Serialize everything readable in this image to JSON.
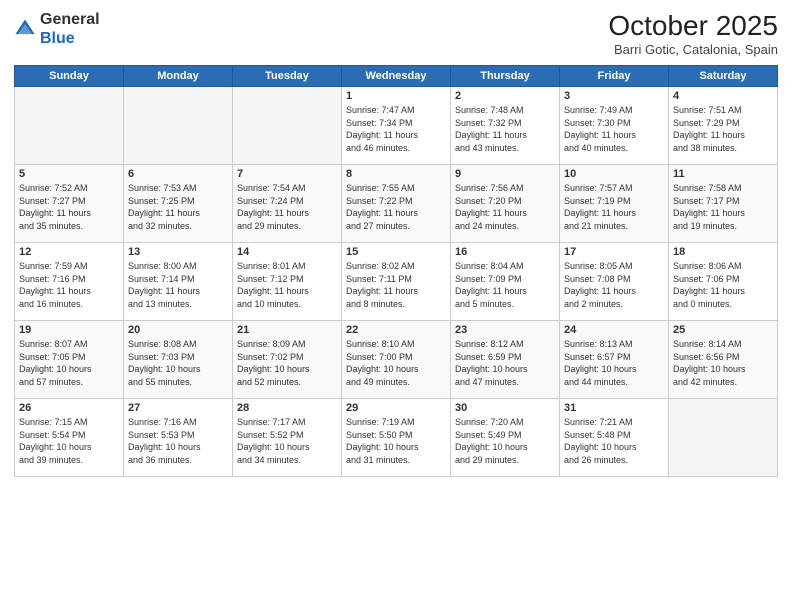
{
  "header": {
    "logo_line1": "General",
    "logo_line2": "Blue",
    "month_title": "October 2025",
    "location": "Barri Gotic, Catalonia, Spain"
  },
  "weekdays": [
    "Sunday",
    "Monday",
    "Tuesday",
    "Wednesday",
    "Thursday",
    "Friday",
    "Saturday"
  ],
  "weeks": [
    [
      {
        "day": "",
        "info": ""
      },
      {
        "day": "",
        "info": ""
      },
      {
        "day": "",
        "info": ""
      },
      {
        "day": "1",
        "info": "Sunrise: 7:47 AM\nSunset: 7:34 PM\nDaylight: 11 hours\nand 46 minutes."
      },
      {
        "day": "2",
        "info": "Sunrise: 7:48 AM\nSunset: 7:32 PM\nDaylight: 11 hours\nand 43 minutes."
      },
      {
        "day": "3",
        "info": "Sunrise: 7:49 AM\nSunset: 7:30 PM\nDaylight: 11 hours\nand 40 minutes."
      },
      {
        "day": "4",
        "info": "Sunrise: 7:51 AM\nSunset: 7:29 PM\nDaylight: 11 hours\nand 38 minutes."
      }
    ],
    [
      {
        "day": "5",
        "info": "Sunrise: 7:52 AM\nSunset: 7:27 PM\nDaylight: 11 hours\nand 35 minutes."
      },
      {
        "day": "6",
        "info": "Sunrise: 7:53 AM\nSunset: 7:25 PM\nDaylight: 11 hours\nand 32 minutes."
      },
      {
        "day": "7",
        "info": "Sunrise: 7:54 AM\nSunset: 7:24 PM\nDaylight: 11 hours\nand 29 minutes."
      },
      {
        "day": "8",
        "info": "Sunrise: 7:55 AM\nSunset: 7:22 PM\nDaylight: 11 hours\nand 27 minutes."
      },
      {
        "day": "9",
        "info": "Sunrise: 7:56 AM\nSunset: 7:20 PM\nDaylight: 11 hours\nand 24 minutes."
      },
      {
        "day": "10",
        "info": "Sunrise: 7:57 AM\nSunset: 7:19 PM\nDaylight: 11 hours\nand 21 minutes."
      },
      {
        "day": "11",
        "info": "Sunrise: 7:58 AM\nSunset: 7:17 PM\nDaylight: 11 hours\nand 19 minutes."
      }
    ],
    [
      {
        "day": "12",
        "info": "Sunrise: 7:59 AM\nSunset: 7:16 PM\nDaylight: 11 hours\nand 16 minutes."
      },
      {
        "day": "13",
        "info": "Sunrise: 8:00 AM\nSunset: 7:14 PM\nDaylight: 11 hours\nand 13 minutes."
      },
      {
        "day": "14",
        "info": "Sunrise: 8:01 AM\nSunset: 7:12 PM\nDaylight: 11 hours\nand 10 minutes."
      },
      {
        "day": "15",
        "info": "Sunrise: 8:02 AM\nSunset: 7:11 PM\nDaylight: 11 hours\nand 8 minutes."
      },
      {
        "day": "16",
        "info": "Sunrise: 8:04 AM\nSunset: 7:09 PM\nDaylight: 11 hours\nand 5 minutes."
      },
      {
        "day": "17",
        "info": "Sunrise: 8:05 AM\nSunset: 7:08 PM\nDaylight: 11 hours\nand 2 minutes."
      },
      {
        "day": "18",
        "info": "Sunrise: 8:06 AM\nSunset: 7:06 PM\nDaylight: 11 hours\nand 0 minutes."
      }
    ],
    [
      {
        "day": "19",
        "info": "Sunrise: 8:07 AM\nSunset: 7:05 PM\nDaylight: 10 hours\nand 57 minutes."
      },
      {
        "day": "20",
        "info": "Sunrise: 8:08 AM\nSunset: 7:03 PM\nDaylight: 10 hours\nand 55 minutes."
      },
      {
        "day": "21",
        "info": "Sunrise: 8:09 AM\nSunset: 7:02 PM\nDaylight: 10 hours\nand 52 minutes."
      },
      {
        "day": "22",
        "info": "Sunrise: 8:10 AM\nSunset: 7:00 PM\nDaylight: 10 hours\nand 49 minutes."
      },
      {
        "day": "23",
        "info": "Sunrise: 8:12 AM\nSunset: 6:59 PM\nDaylight: 10 hours\nand 47 minutes."
      },
      {
        "day": "24",
        "info": "Sunrise: 8:13 AM\nSunset: 6:57 PM\nDaylight: 10 hours\nand 44 minutes."
      },
      {
        "day": "25",
        "info": "Sunrise: 8:14 AM\nSunset: 6:56 PM\nDaylight: 10 hours\nand 42 minutes."
      }
    ],
    [
      {
        "day": "26",
        "info": "Sunrise: 7:15 AM\nSunset: 5:54 PM\nDaylight: 10 hours\nand 39 minutes."
      },
      {
        "day": "27",
        "info": "Sunrise: 7:16 AM\nSunset: 5:53 PM\nDaylight: 10 hours\nand 36 minutes."
      },
      {
        "day": "28",
        "info": "Sunrise: 7:17 AM\nSunset: 5:52 PM\nDaylight: 10 hours\nand 34 minutes."
      },
      {
        "day": "29",
        "info": "Sunrise: 7:19 AM\nSunset: 5:50 PM\nDaylight: 10 hours\nand 31 minutes."
      },
      {
        "day": "30",
        "info": "Sunrise: 7:20 AM\nSunset: 5:49 PM\nDaylight: 10 hours\nand 29 minutes."
      },
      {
        "day": "31",
        "info": "Sunrise: 7:21 AM\nSunset: 5:48 PM\nDaylight: 10 hours\nand 26 minutes."
      },
      {
        "day": "",
        "info": ""
      }
    ]
  ]
}
